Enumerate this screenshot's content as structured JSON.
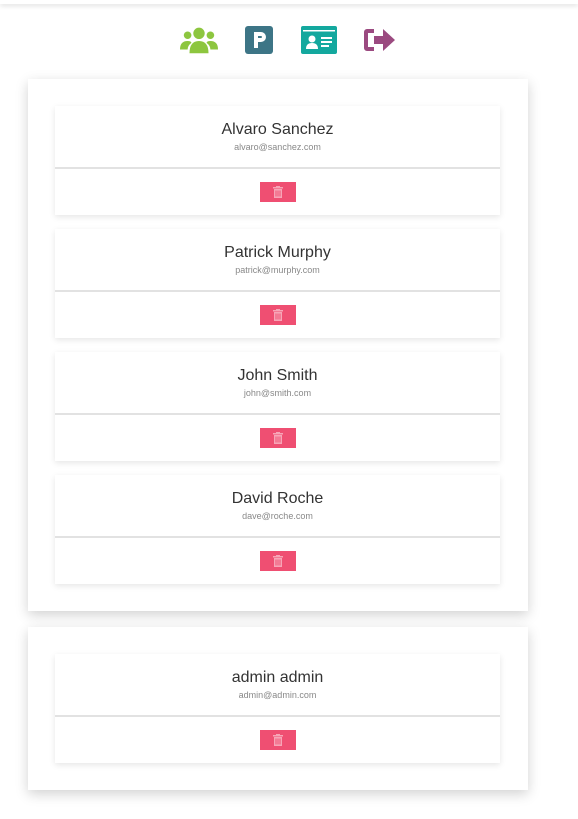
{
  "nav": {
    "icons": [
      "users-icon",
      "parking-icon",
      "id-card-icon",
      "sign-out-icon"
    ],
    "colors": {
      "users": "#8dc63f",
      "parking": "#3d7586",
      "idcard": "#13a89e",
      "signout": "#9b4a80"
    }
  },
  "users": [
    {
      "name": "Alvaro Sanchez",
      "email": "alvaro@sanchez.com"
    },
    {
      "name": "Patrick Murphy",
      "email": "patrick@murphy.com"
    },
    {
      "name": "John Smith",
      "email": "john@smith.com"
    },
    {
      "name": "David Roche",
      "email": "dave@roche.com"
    }
  ],
  "admins": [
    {
      "name": "admin admin",
      "email": "admin@admin.com"
    }
  ],
  "delete_color": "#ef4f72"
}
